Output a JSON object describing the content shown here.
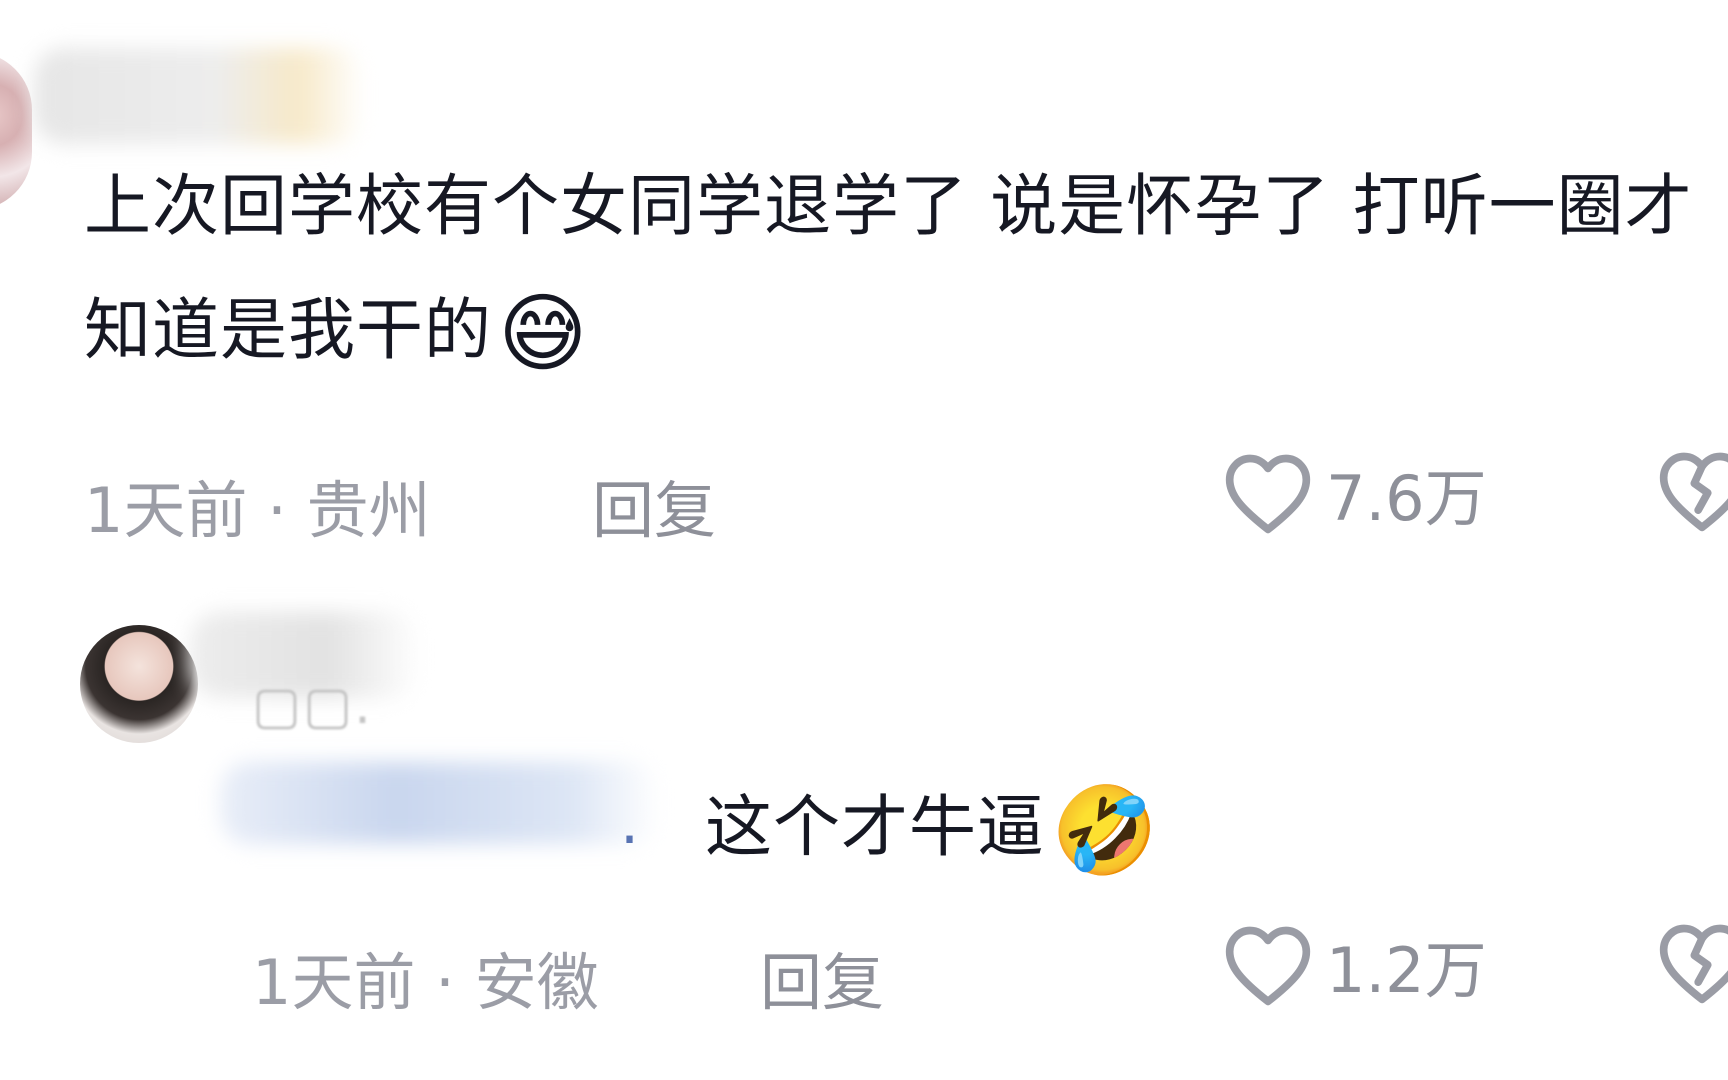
{
  "comments": [
    {
      "content": "上次回学校有个女同学退学了 说是怀孕了 打听一圈才知道是我干的",
      "emoji": "😅",
      "time_location": "1天前 · 贵州",
      "reply_label": "回复",
      "likes": "7.6万"
    },
    {
      "mention_tail": ".",
      "content": "这个才牛逼",
      "emoji": "🤣",
      "time_location": "1天前 · 安徽",
      "reply_label": "回复",
      "likes": "1.2万"
    }
  ],
  "icons": {
    "like": "heart-outline-icon",
    "dislike": "broken-heart-icon"
  },
  "colors": {
    "text": "#161823",
    "meta": "#9b9da6",
    "mention": "#5873b3"
  }
}
